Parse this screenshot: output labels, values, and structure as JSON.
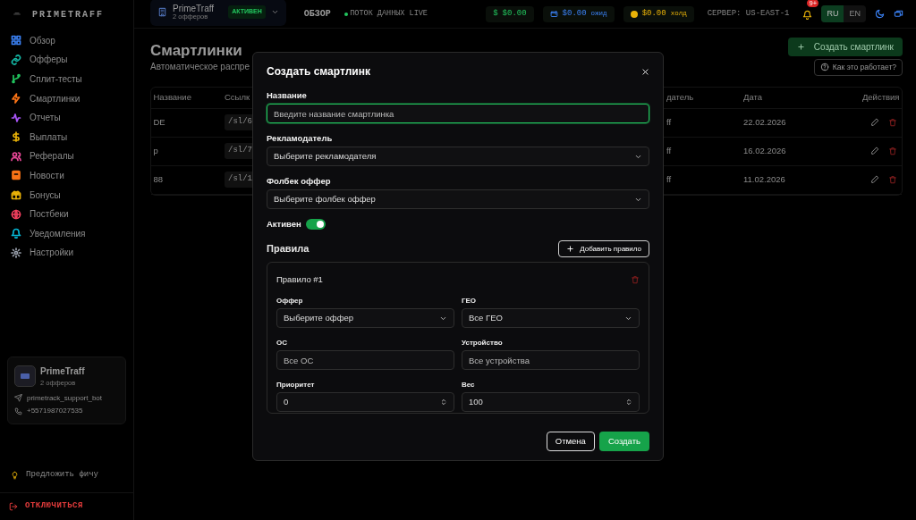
{
  "topbar": {
    "logo": "PRIMETRAFF",
    "account": {
      "name": "PrimeTraff",
      "subtitle": "2 офферов",
      "status": "АКТИВЕН"
    },
    "section": "ОБЗОР",
    "live": "ПОТОК ДАННЫХ LIVE",
    "balances": [
      {
        "kind": "cash",
        "symbol": "$",
        "amount": "$0.00"
      },
      {
        "kind": "wallet",
        "amount": "$0.00",
        "note": "ожид"
      },
      {
        "kind": "coin",
        "amount": "$0.00",
        "note": "холд"
      }
    ],
    "server": "СЕРВЕР: US-EAST-1",
    "notifications": "9+",
    "languages": [
      {
        "label": "RU",
        "selected": true
      },
      {
        "label": "EN",
        "selected": false
      }
    ]
  },
  "sidebar": {
    "items": [
      {
        "label": "Обзор",
        "color": "#3b82f6"
      },
      {
        "label": "Офферы",
        "color": "#14b8a6"
      },
      {
        "label": "Сплит-тесты",
        "color": "#22c55e"
      },
      {
        "label": "Смартлинки",
        "color": "#f97316"
      },
      {
        "label": "Отчеты",
        "color": "#a855f7"
      },
      {
        "label": "Выплаты",
        "color": "#eab308"
      },
      {
        "label": "Рефералы",
        "color": "#ec4899"
      },
      {
        "label": "Новости",
        "color": "#f97316"
      },
      {
        "label": "Бонусы",
        "color": "#eab308"
      },
      {
        "label": "Постбеки",
        "color": "#f43f5e"
      },
      {
        "label": "Уведомления",
        "color": "#06b6d4"
      },
      {
        "label": "Настройки",
        "color": "#9ca3af"
      }
    ],
    "account_card": {
      "name": "PrimeTraff",
      "subtitle": "2 офферов",
      "telegram": "primetrack_support_bot",
      "phone": "+5571987027535"
    },
    "suggest": "Предложить фичу",
    "logout": "ОТКЛЮЧИТЬСЯ"
  },
  "page": {
    "title": "Смартлинки",
    "subtitle": "Автоматическое распре",
    "create_button": "Создать смартлинк",
    "help_button": "Как это работает?",
    "table": {
      "columns": [
        "Название",
        "Ссылк",
        "датель",
        "Дата",
        "Действия"
      ],
      "rows": [
        {
          "cells": [
            "DE",
            "/sl/6",
            "ff",
            "22.02.2026"
          ]
        },
        {
          "cells": [
            "p",
            "/sl/7",
            "ff",
            "16.02.2026"
          ]
        },
        {
          "cells": [
            "88",
            "/sl/1",
            "ff",
            "11.02.2026"
          ]
        }
      ]
    }
  },
  "modal": {
    "title": "Создать смартлинк",
    "name_field": {
      "label": "Название",
      "placeholder": "Введите название смартлинка",
      "focused": true
    },
    "advertiser": {
      "label": "Рекламодатель",
      "value": "Выберите рекламодателя"
    },
    "fallback": {
      "label": "Фолбек оффер",
      "value": "Выберите фолбек оффер"
    },
    "active": {
      "label": "Активен",
      "on": true
    },
    "rules_title": "Правила",
    "add_rule_button": "Добавить правило",
    "rules": [
      {
        "title": "Правило #1",
        "fields": [
          {
            "kind": "select",
            "label": "Оффер",
            "value": "Выберите оффер"
          },
          {
            "kind": "select",
            "label": "ГЕО",
            "value": "Все ГЕО"
          },
          {
            "kind": "text",
            "label": "ОС",
            "placeholder": "Все ОС"
          },
          {
            "kind": "text",
            "label": "Устройство",
            "placeholder": "Все устройства"
          },
          {
            "kind": "number",
            "label": "Приоритет",
            "value": "0"
          },
          {
            "kind": "number",
            "label": "Вес",
            "value": "100"
          }
        ]
      }
    ],
    "cancel_button": "Отмена",
    "submit_button": "Создать"
  }
}
